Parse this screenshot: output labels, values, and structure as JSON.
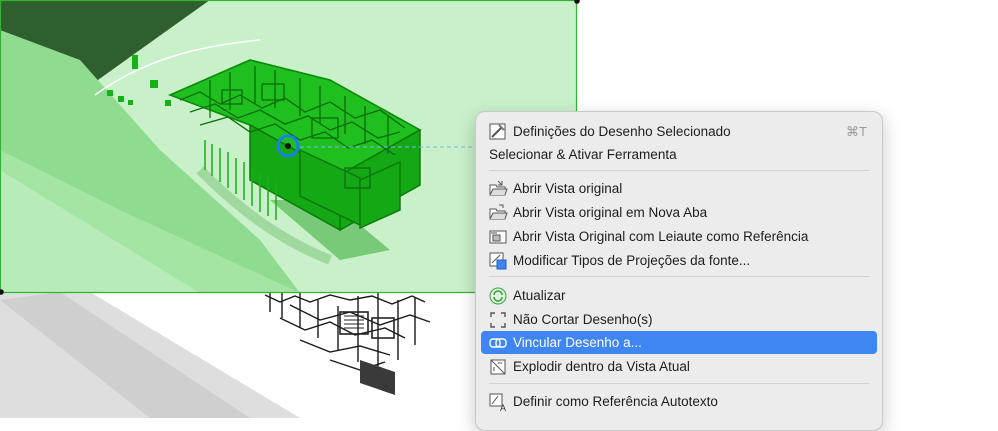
{
  "context_menu": {
    "items": [
      {
        "label": "Definições do Desenho Selecionado",
        "shortcut": "⌘T",
        "icon": "drawing-settings-icon"
      },
      {
        "label": "Selecionar & Ativar Ferramenta"
      },
      {
        "label": "Abrir Vista original",
        "icon": "open-folder-icon"
      },
      {
        "label": "Abrir Vista original em Nova Aba",
        "icon": "open-folder-tab-icon"
      },
      {
        "label": "Abrir Vista Original com Leiaute como Referência",
        "icon": "layout-reference-icon"
      },
      {
        "label": "Modificar Tipos de Projeções da fonte...",
        "icon": "projection-types-icon"
      },
      {
        "label": "Atualizar",
        "icon": "refresh-icon"
      },
      {
        "label": "Não Cortar Desenho(s)",
        "icon": "crop-corners-icon"
      },
      {
        "label": "Vincular Desenho a...",
        "icon": "link-drawing-icon",
        "selected": true
      },
      {
        "label": "Explodir dentro da Vista Atual",
        "icon": "explode-icon"
      },
      {
        "label": "Definir como Referência Autotexto",
        "icon": "autotext-reference-icon"
      }
    ]
  },
  "colors": {
    "selection_fill": "#dcf9dc",
    "selection_border": "#2fb52f",
    "model_green": "#17b117",
    "menu_highlight": "#3f86f3"
  }
}
